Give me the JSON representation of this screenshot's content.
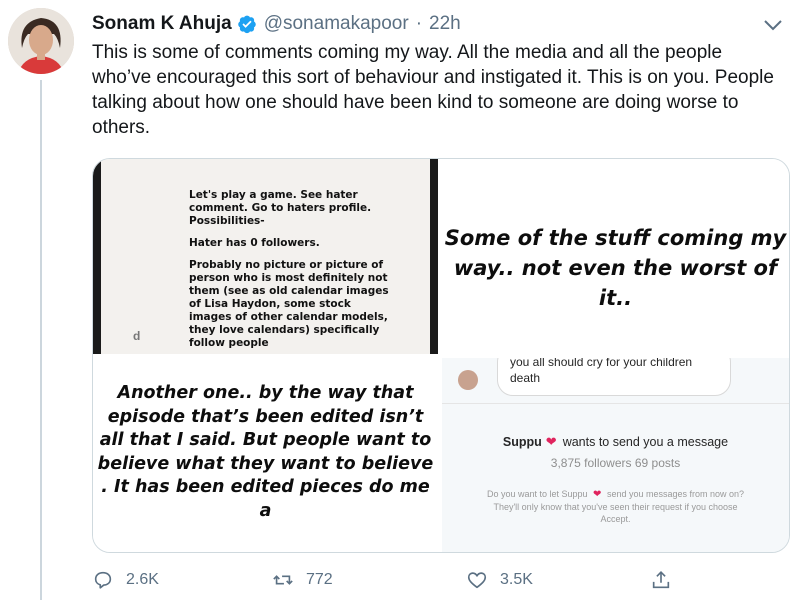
{
  "tweet": {
    "author_name": "Sonam K Ahuja",
    "handle": "@sonamakapoor",
    "separator": "·",
    "time": "22h",
    "text": "This is some of comments coming my way. All the media and all the people who’ve encouraged this sort of behaviour and instigated it. This is on you. People talking about how one should have been kind to someone are doing worse to others."
  },
  "media": {
    "img1": {
      "lines": [
        "Let's play a game. See hater comment. Go to haters profile. Possibilities-",
        "Hater has 0 followers.",
        "Probably no picture or picture of person who is most definitely not them (see as old calendar images of Lisa Haydon, some stock images of other calendar models, they love calendars) specifically follow people"
      ],
      "side_glyph": "d"
    },
    "img2": {
      "text": "Some of the stuff coming my way.. not even the worst of it.."
    },
    "img3": {
      "text": "Another one.. by the way that episode that’s been edited isn’t all that I said. But people want to believe what they want to believe . It has been edited pieces do me a"
    },
    "img4": {
      "bubble_text": "you all should cry for your children death",
      "username": "Suppu",
      "heart": "❤",
      "message_request": "wants to send you a message",
      "followers": "3,875 followers",
      "posts": "69 posts",
      "note_pre": "Do you want to let Suppu",
      "note_post": "send you messages from now on? They'll only know that you've seen their request if you choose Accept."
    }
  },
  "actions": {
    "reply_count": "2.6K",
    "retweet_count": "772",
    "like_count": "3.5K"
  },
  "colors": {
    "verified": "#1da1f2",
    "secondary_text": "#5b7083",
    "heart": "#e0245e"
  },
  "icons": {
    "reply": "reply-icon",
    "retweet": "retweet-icon",
    "like": "like-icon",
    "share": "share-icon",
    "verified": "verified-badge-icon",
    "menu": "chevron-down-icon"
  }
}
